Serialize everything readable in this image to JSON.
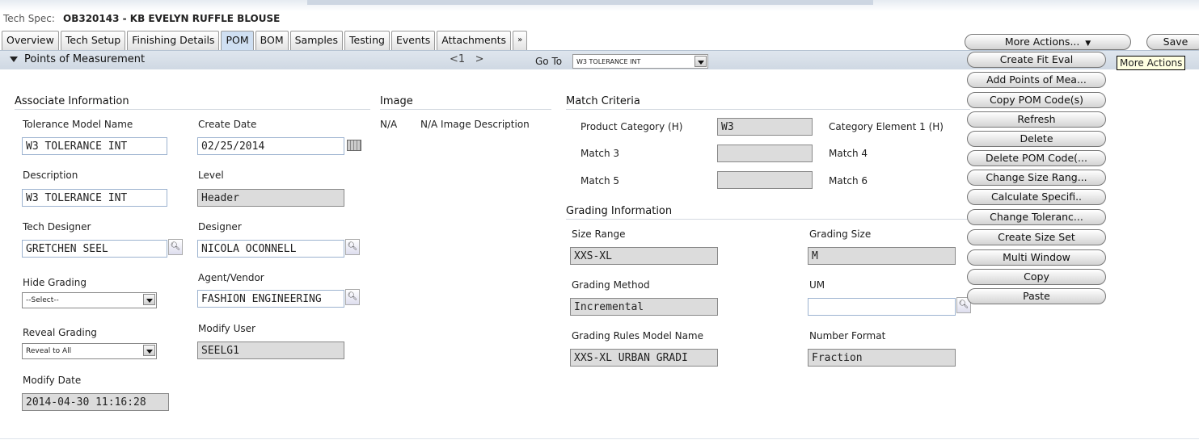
{
  "header": {
    "title_label": "Tech Spec:",
    "title_value": "OB320143 - KB EVELYN RUFFLE BLOUSE"
  },
  "tabs": [
    "Overview",
    "Tech Setup",
    "Finishing Details",
    "POM",
    "BOM",
    "Samples",
    "Testing",
    "Events",
    "Attachments",
    "»"
  ],
  "section": {
    "title": "Points of Measurement",
    "pager_prev": "<1",
    "pager_next": ">",
    "goto_label": "Go To",
    "goto_value": "W3 TOLERANCE INT"
  },
  "associate": {
    "heading": "Associate Information",
    "tolerance_label": "Tolerance Model Name",
    "tolerance_value": "W3 TOLERANCE INT",
    "create_date_label": "Create Date",
    "create_date_value": "02/25/2014",
    "description_label": "Description",
    "description_value": "W3 TOLERANCE INT",
    "level_label": "Level",
    "level_value": "Header",
    "tech_designer_label": "Tech Designer",
    "tech_designer_value": "GRETCHEN SEEL",
    "designer_label": "Designer",
    "designer_value": "NICOLA OCONNELL",
    "hide_grading_label": "Hide Grading",
    "hide_grading_value": "--Select--",
    "agent_label": "Agent/Vendor",
    "agent_value": "FASHION ENGINEERING",
    "reveal_label": "Reveal Grading",
    "reveal_value": "Reveal to All",
    "modify_user_label": "Modify User",
    "modify_user_value": "SEELG1",
    "modify_date_label": "Modify Date",
    "modify_date_value": "2014-04-30 11:16:28"
  },
  "image": {
    "heading": "Image",
    "na": "N/A",
    "desc": "N/A Image Description"
  },
  "match": {
    "heading": "Match Criteria",
    "product_category_label": "Product Category (H)",
    "product_category_value": "W3",
    "category_element_label": "Category Element 1 (H)",
    "match3_label": "Match 3",
    "match4_label": "Match 4",
    "match5_label": "Match 5",
    "match6_label": "Match 6"
  },
  "grading": {
    "heading": "Grading Information",
    "size_range_label": "Size Range",
    "size_range_value": "XXS-XL",
    "grading_size_label": "Grading Size",
    "grading_size_value": "M",
    "method_label": "Grading Method",
    "method_value": "Incremental",
    "um_label": "UM",
    "rules_label": "Grading Rules Model Name",
    "rules_value": "XXS-XL URBAN GRADI",
    "number_format_label": "Number Format",
    "number_format_value": "Fraction"
  },
  "actions": {
    "more_actions": "More Actions...",
    "save": "Save",
    "tooltip": "More Actions",
    "menu": [
      "Create Fit Eval",
      "Add Points of Mea...",
      "Copy POM Code(s)",
      "Refresh",
      "Delete",
      "Delete POM Code(...",
      "Change Size Rang...",
      "Calculate Specifi..",
      "Change Toleranc...",
      "Create Size Set",
      "Multi Window",
      "Copy",
      "Paste"
    ]
  }
}
